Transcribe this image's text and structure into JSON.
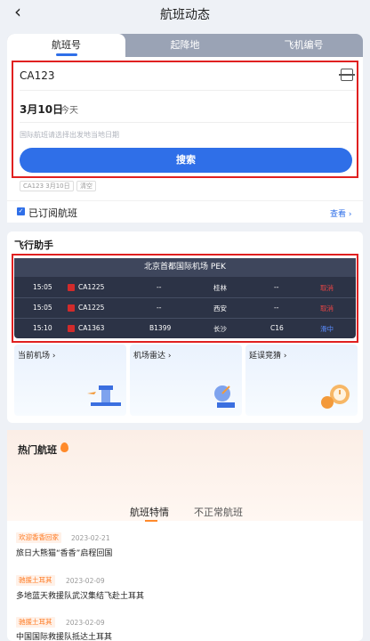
{
  "header": {
    "title": "航班动态",
    "back_icon": "chevron-left-icon"
  },
  "tabs": [
    {
      "label": "航班号",
      "active": true
    },
    {
      "label": "起降地",
      "active": false
    },
    {
      "label": "飞机编号",
      "active": false
    }
  ],
  "search": {
    "flight_number": "CA123",
    "date": "3月10日",
    "today_label": "今天",
    "hint": "国际航班请选择出发地当地日期",
    "button_label": "搜索",
    "history": [
      "CA123 3月10日",
      "清空"
    ]
  },
  "subscribed": {
    "label": "已订阅航班",
    "view_all": "查看 ›"
  },
  "assistant": {
    "title": "飞行助手",
    "board_title": "北京首都国际机场 PEK",
    "rows": [
      {
        "time": "15:05",
        "flight": "CA1225",
        "aircraft": "--",
        "city": "桂林",
        "gate": "--",
        "status": "取消",
        "status_color": "#e64545"
      },
      {
        "time": "15:05",
        "flight": "CA1225",
        "aircraft": "--",
        "city": "西安",
        "gate": "--",
        "status": "取消",
        "status_color": "#e64545"
      },
      {
        "time": "15:10",
        "flight": "CA1363",
        "aircraft": "B1399",
        "city": "长沙",
        "gate": "C16",
        "status": "滑中",
        "status_color": "#5a8cff"
      }
    ],
    "tiles": [
      {
        "label": "当前机场 ›",
        "icon": "airport-tower-icon"
      },
      {
        "label": "机场雷达 ›",
        "icon": "radar-dish-icon"
      },
      {
        "label": "延误竞猜 ›",
        "icon": "clock-coin-icon"
      }
    ]
  },
  "hot": {
    "title": "热门航班",
    "sub_tabs": [
      "航班特情",
      "不正常航班"
    ],
    "news": [
      {
        "tag": "欢迎香香回家",
        "date": "2023-02-21",
        "title": "旅日大熊猫“香香”启程回国"
      },
      {
        "tag": "驰援土耳其",
        "date": "2023-02-09",
        "title": "多地蓝天救援队武汉集结飞赴土耳其"
      },
      {
        "tag": "驰援土耳其",
        "date": "2023-02-09",
        "title": "中国国际救援队抵达土耳其"
      }
    ]
  },
  "colors": {
    "accent": "#2f6fe8",
    "highlight_border": "#e02020",
    "board_bg": "#2c3346",
    "hot_accent": "#ff8a2b"
  }
}
